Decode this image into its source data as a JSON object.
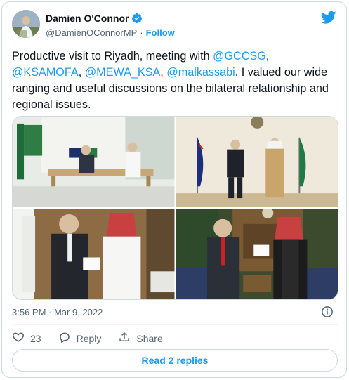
{
  "author": {
    "display_name": "Damien O'Connor",
    "handle": "@DamienOConnorMP",
    "separator": "·",
    "follow_label": "Follow"
  },
  "tweet": {
    "text_parts": {
      "p1": "Productive visit to Riyadh, meeting with ",
      "m1": "@GCCSG",
      "p2": ", ",
      "m2": "@KSAMOFA",
      "p3": ", ",
      "m3": "@MEWA_KSA",
      "p4": ", ",
      "m4": "@malkassabi",
      "p5": ". I valued our wide ranging and useful discussions on the bilateral relationship and regional issues."
    },
    "timestamp": "3:56 PM · Mar 9, 2022",
    "likes": "23",
    "reply_label": "Reply",
    "share_label": "Share",
    "read_replies_label": "Read 2 replies"
  },
  "colors": {
    "accent": "#1d9bf0",
    "text": "#0f1419",
    "muted": "#536471",
    "border": "#cfd9de"
  },
  "icons": [
    "verified-badge-icon",
    "twitter-bird-icon",
    "info-icon",
    "heart-icon",
    "reply-bubble-icon",
    "share-icon"
  ]
}
